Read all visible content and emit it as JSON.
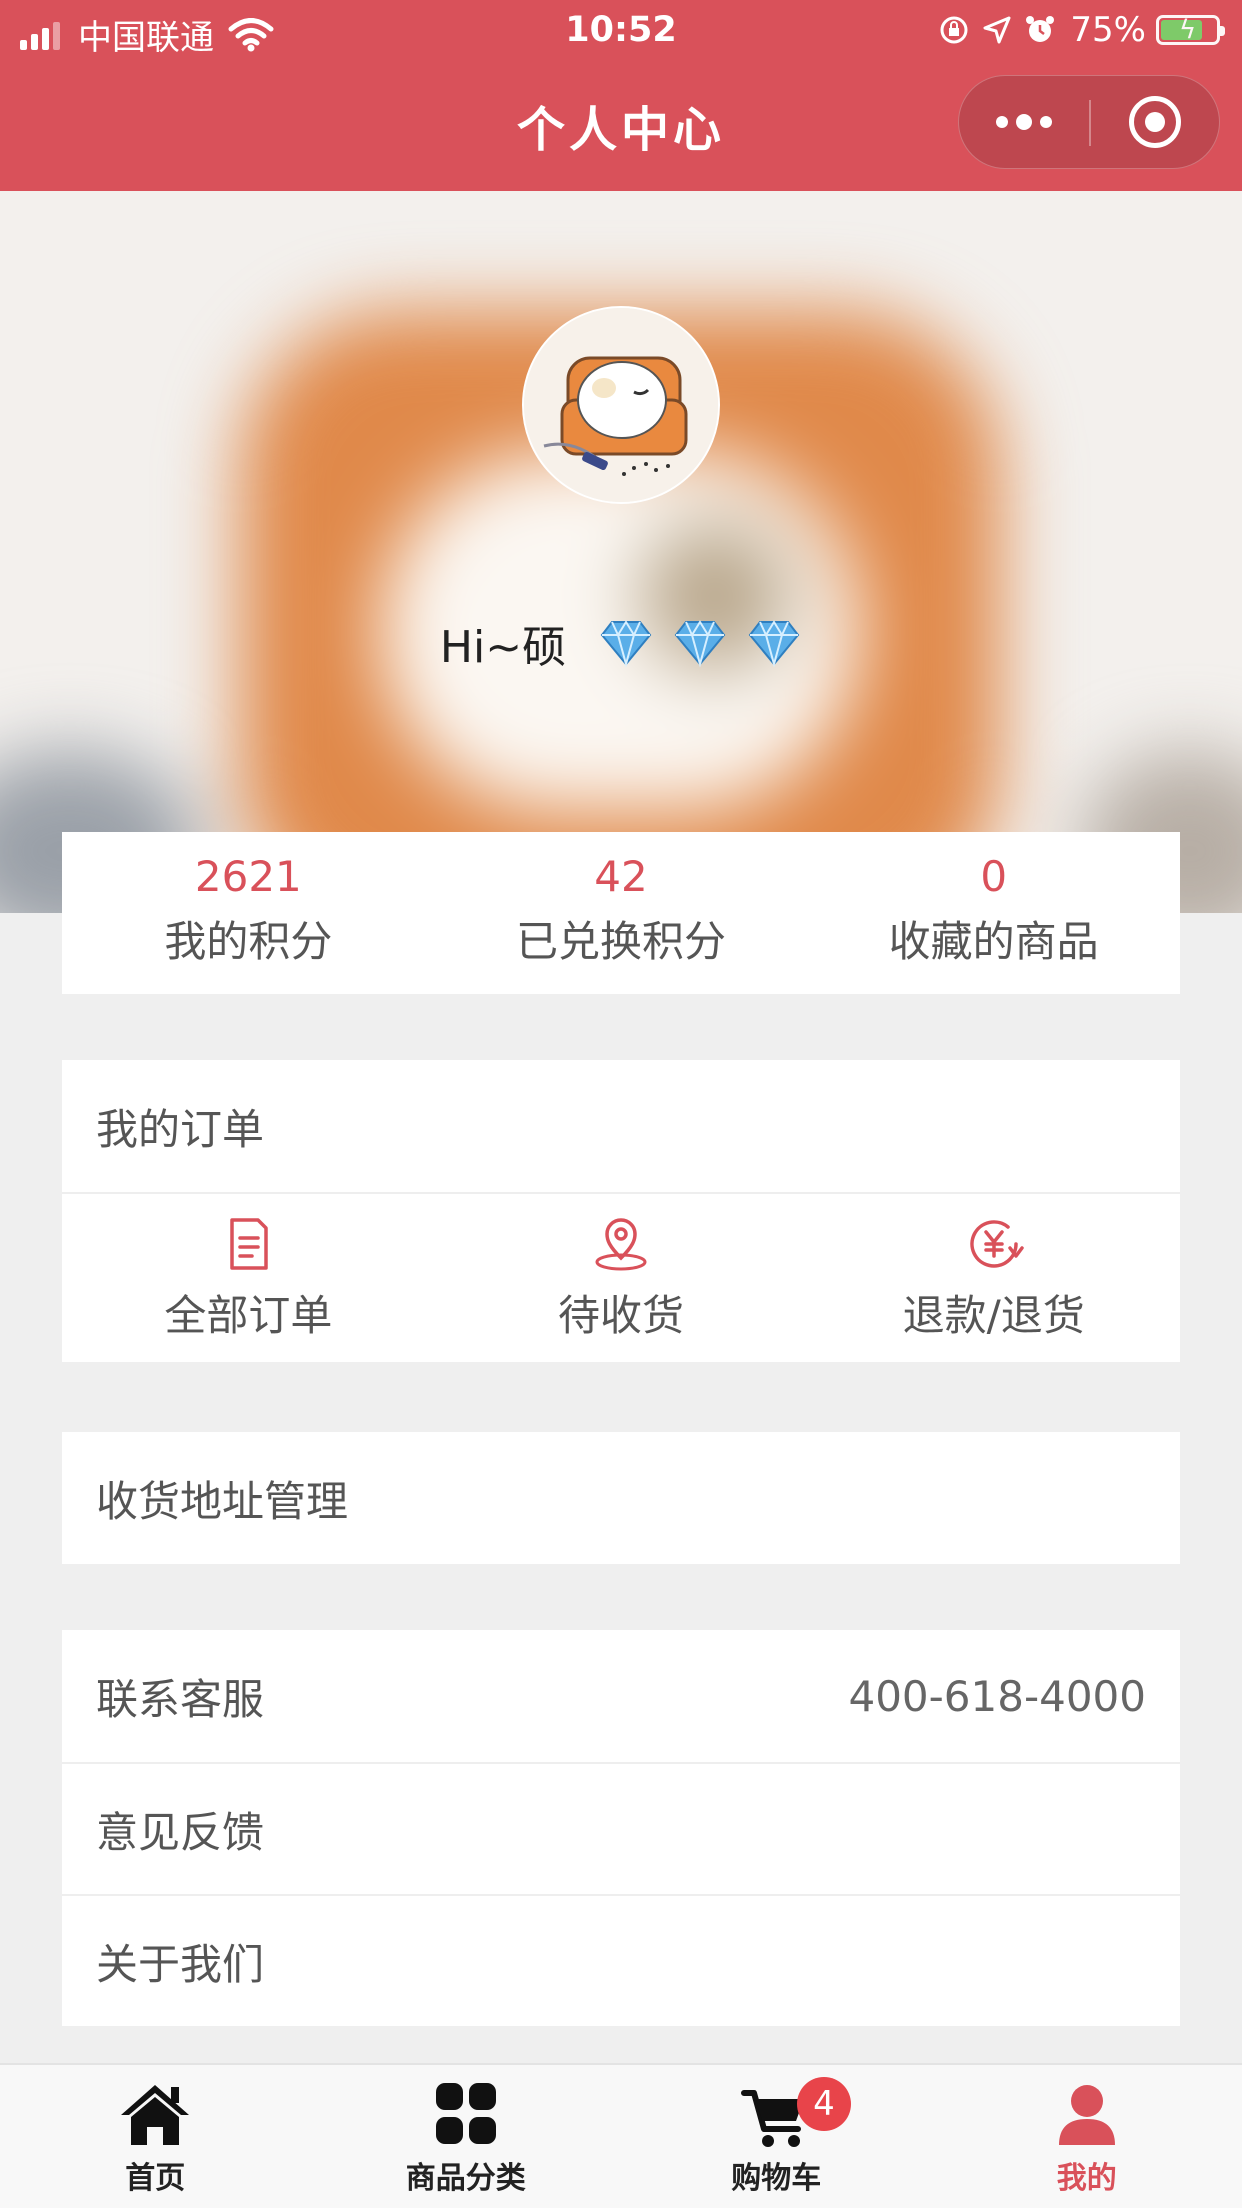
{
  "status_bar": {
    "carrier": "中国联通",
    "time": "10:52",
    "battery": "75%"
  },
  "title_bar": {
    "title": "个人中心"
  },
  "profile": {
    "greeting": "Hi~硕",
    "gem_count": 3
  },
  "stats": [
    {
      "value": "2621",
      "label": "我的积分"
    },
    {
      "value": "42",
      "label": "已兑换积分"
    },
    {
      "value": "0",
      "label": "收藏的商品"
    }
  ],
  "orders": {
    "title": "我的订单",
    "items": [
      {
        "label": "全部订单",
        "icon": "document-icon"
      },
      {
        "label": "待收货",
        "icon": "location-pin-icon"
      },
      {
        "label": "退款/退货",
        "icon": "refund-yen-icon"
      }
    ]
  },
  "address": {
    "label": "收货地址管理"
  },
  "service": {
    "contact_label": "联系客服",
    "contact_phone": "400-618-4000",
    "feedback_label": "意见反馈",
    "about_label": "关于我们"
  },
  "tabs": [
    {
      "label": "首页",
      "icon": "home-icon"
    },
    {
      "label": "商品分类",
      "icon": "grid-icon"
    },
    {
      "label": "购物车",
      "icon": "cart-icon",
      "badge": "4"
    },
    {
      "label": "我的",
      "icon": "user-icon"
    }
  ],
  "colors": {
    "accent": "#d9515a",
    "page_background": "#efefef"
  }
}
